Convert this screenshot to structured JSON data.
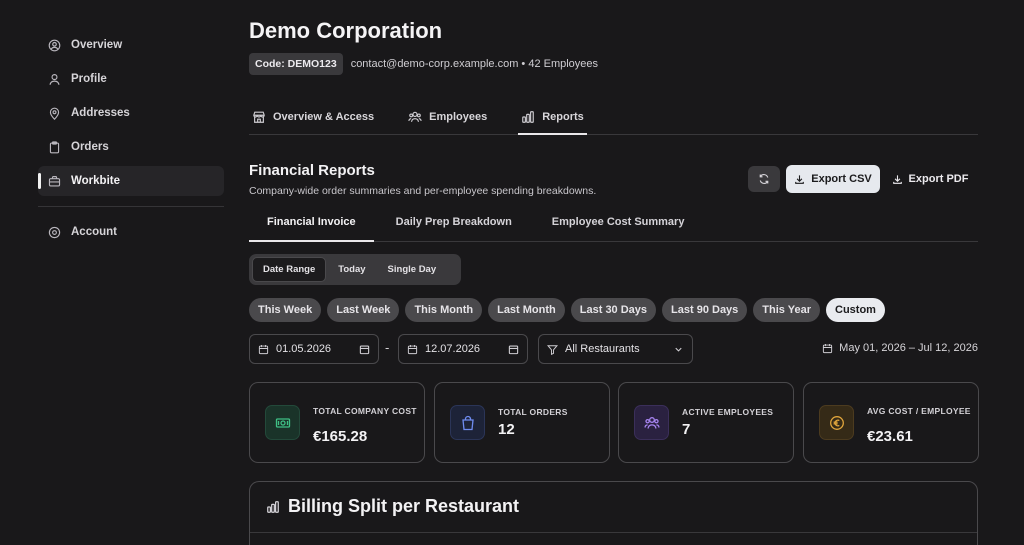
{
  "sidebar": {
    "items": [
      {
        "label": "Overview",
        "icon": "user-circle-icon"
      },
      {
        "label": "Profile",
        "icon": "user-icon"
      },
      {
        "label": "Addresses",
        "icon": "map-pin-icon"
      },
      {
        "label": "Orders",
        "icon": "clipboard-icon"
      },
      {
        "label": "Workbite",
        "icon": "briefcase-icon",
        "active": true
      }
    ],
    "account_label": "Account"
  },
  "company": {
    "name": "Demo Corporation",
    "code": "Code: DEMO123",
    "contact": "contact@demo-corp.example.com • 42 Employees"
  },
  "top_tabs": [
    {
      "label": "Overview & Access",
      "icon": "store-icon"
    },
    {
      "label": "Employees",
      "icon": "users-icon"
    },
    {
      "label": "Reports",
      "icon": "bar-chart-icon",
      "active": true
    }
  ],
  "reports": {
    "title": "Financial Reports",
    "subtitle": "Company-wide order summaries and per-employee spending breakdowns.",
    "export_csv": "Export CSV",
    "export_pdf": "Export PDF"
  },
  "sub_tabs": [
    "Financial Invoice",
    "Daily Prep Breakdown",
    "Employee Cost Summary"
  ],
  "range_modes": [
    "Date Range",
    "Today",
    "Single Day"
  ],
  "presets": [
    "This Week",
    "Last Week",
    "This Month",
    "Last Month",
    "Last 30 Days",
    "Last 90 Days",
    "This Year",
    "Custom"
  ],
  "filters": {
    "start_date": "01.05.2026",
    "end_date": "12.07.2026",
    "restaurant": "All Restaurants",
    "range_display": "May 01, 2026 – Jul 12, 2026"
  },
  "stats": [
    {
      "label": "TOTAL COMPANY COST",
      "value": "€165.28",
      "icon": "banknote-icon",
      "color": "#3fbf85"
    },
    {
      "label": "TOTAL ORDERS",
      "value": "12",
      "icon": "shopping-bag-icon",
      "color": "#6f8cf0"
    },
    {
      "label": "ACTIVE EMPLOYEES",
      "value": "7",
      "icon": "users-icon",
      "color": "#a784f0"
    },
    {
      "label": "AVG COST / EMPLOYEE",
      "value": "€23.61",
      "icon": "euro-coin-icon",
      "color": "#e0a53c"
    }
  ],
  "billing": {
    "title": "Billing Split per Restaurant"
  },
  "colors": {
    "background": "#19181a",
    "accent_light": "#e9ebef"
  }
}
